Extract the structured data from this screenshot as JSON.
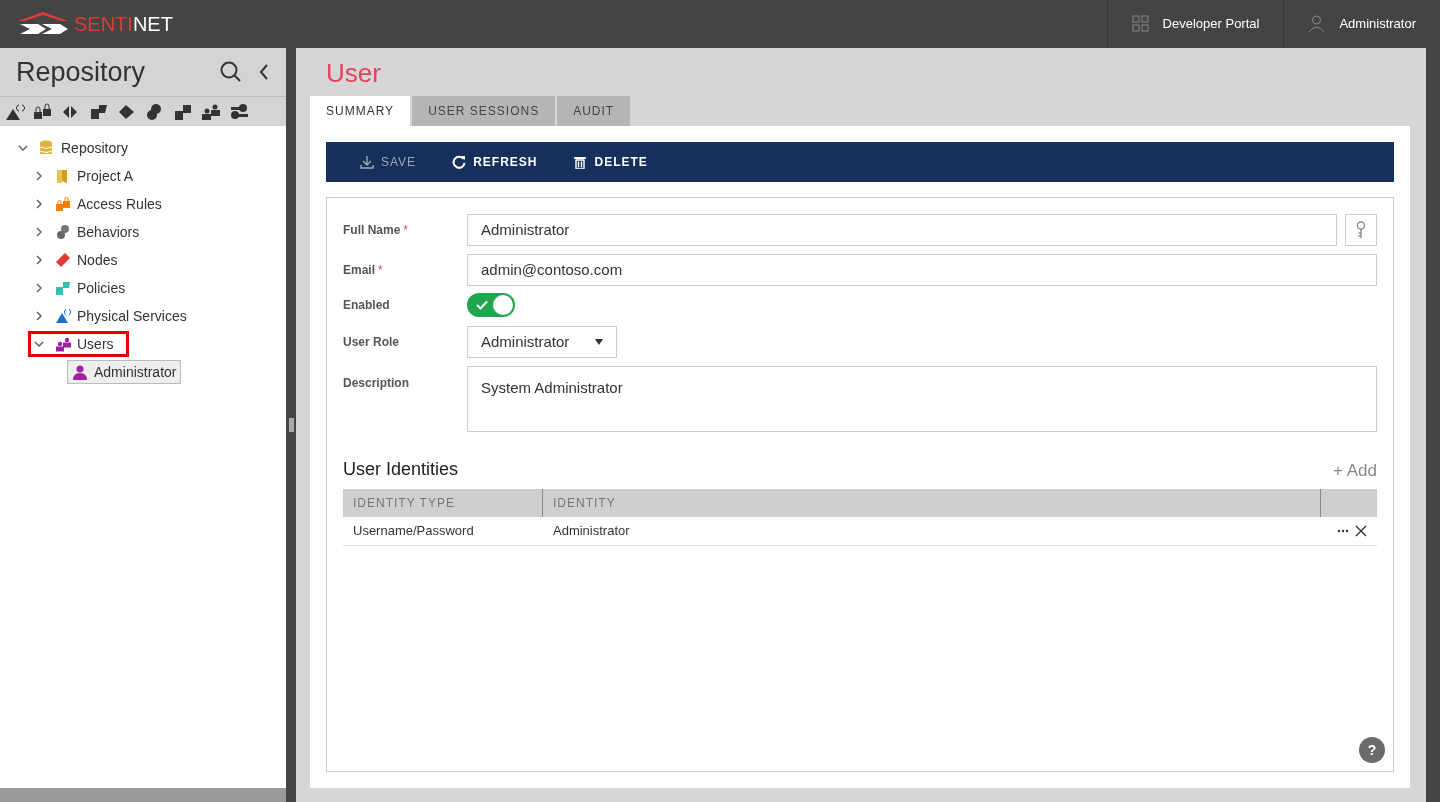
{
  "header": {
    "logo_text_a": "SENTI",
    "logo_text_b": "NET",
    "links": [
      {
        "kind": "grid",
        "label": "Developer Portal"
      },
      {
        "kind": "user",
        "label": "Administrator"
      }
    ]
  },
  "sidebar": {
    "title": "Repository",
    "tree": [
      {
        "label": "Repository",
        "kind": "database",
        "expanded": true,
        "selected": false,
        "outlined": false,
        "children": [
          {
            "label": "Project A",
            "kind": "folder",
            "expanded": false,
            "selected": false,
            "outlined": false
          },
          {
            "label": "Access Rules",
            "kind": "lock",
            "expanded": false,
            "selected": false,
            "outlined": false
          },
          {
            "label": "Behaviors",
            "kind": "behavior",
            "expanded": false,
            "selected": false,
            "outlined": false
          },
          {
            "label": "Nodes",
            "kind": "node",
            "expanded": false,
            "selected": false,
            "outlined": false
          },
          {
            "label": "Policies",
            "kind": "policy",
            "expanded": false,
            "selected": false,
            "outlined": false
          },
          {
            "label": "Physical Services",
            "kind": "service",
            "expanded": false,
            "selected": false,
            "outlined": false
          },
          {
            "label": "Users",
            "kind": "users",
            "expanded": true,
            "selected": false,
            "outlined": true,
            "children": [
              {
                "label": "Administrator",
                "kind": "user",
                "selected": true,
                "outlined": false
              }
            ]
          }
        ]
      }
    ]
  },
  "page": {
    "title": "User",
    "tabs": [
      {
        "label": "SUMMARY",
        "selected": true
      },
      {
        "label": "USER SESSIONS",
        "selected": false
      },
      {
        "label": "AUDIT",
        "selected": false
      }
    ],
    "toolbar": [
      {
        "kind": "save",
        "label": "SAVE",
        "disabled": true
      },
      {
        "kind": "refresh",
        "label": "REFRESH",
        "disabled": false
      },
      {
        "kind": "delete",
        "label": "DELETE",
        "disabled": false
      }
    ],
    "form": {
      "full_name": {
        "label": "Full Name",
        "required_mark": "*",
        "value": "Administrator"
      },
      "email": {
        "label": "Email",
        "required_mark": "*",
        "value": "admin@contoso.com"
      },
      "enabled": {
        "label": "Enabled",
        "on": true
      },
      "user_role": {
        "label": "User Role",
        "value": "Administrator"
      },
      "description": {
        "label": "Description",
        "value": "System Administrator"
      }
    },
    "identities": {
      "title": "User Identities",
      "add": "+ Add",
      "columns": [
        "IDENTITY TYPE",
        "IDENTITY"
      ],
      "rows": [
        [
          "Username/Password",
          "Administrator"
        ]
      ]
    },
    "help": "?"
  }
}
